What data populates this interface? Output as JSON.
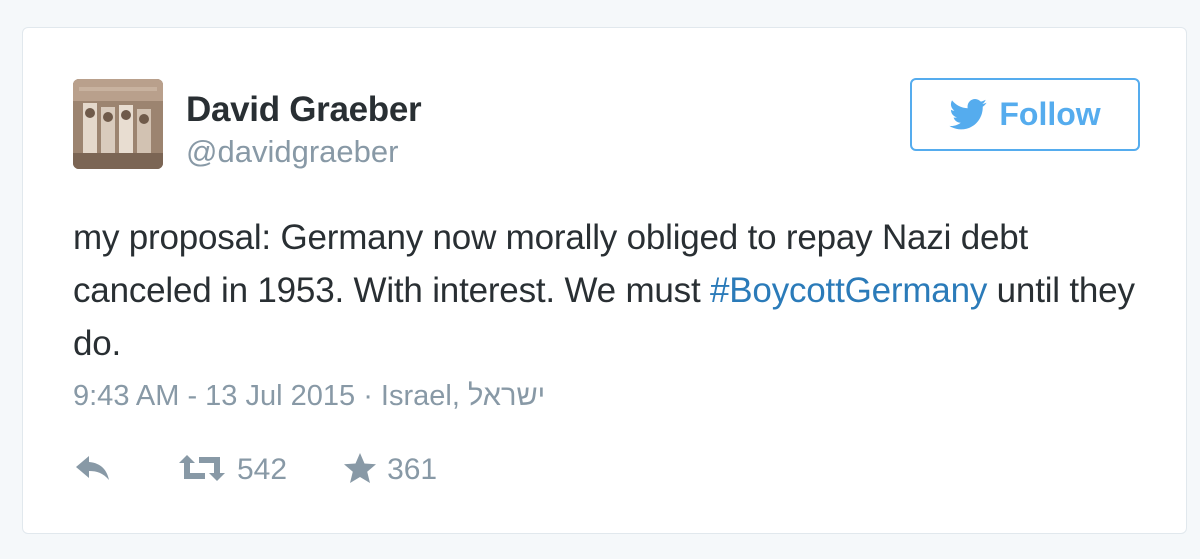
{
  "user": {
    "display_name": "David Graeber",
    "handle": "@davidgraeber"
  },
  "follow_button": {
    "label": "Follow",
    "icon": "twitter-bird-icon"
  },
  "tweet": {
    "text_before": "my proposal: Germany now morally obliged to repay Nazi debt canceled in 1953. With interest. We must ",
    "hashtag": "#BoycottGermany",
    "text_after": " until they do."
  },
  "meta": {
    "timestamp": "9:43 AM - 13 Jul 2015",
    "separator": " · ",
    "location": "Israel, ישראל"
  },
  "actions": {
    "reply_icon": "reply-icon",
    "retweet_icon": "retweet-icon",
    "retweet_count": "542",
    "favorite_icon": "star-icon",
    "favorite_count": "361"
  },
  "colors": {
    "accent": "#55acee",
    "hashtag": "#2b7bb9",
    "text": "#292f33",
    "muted": "#8899a6"
  }
}
